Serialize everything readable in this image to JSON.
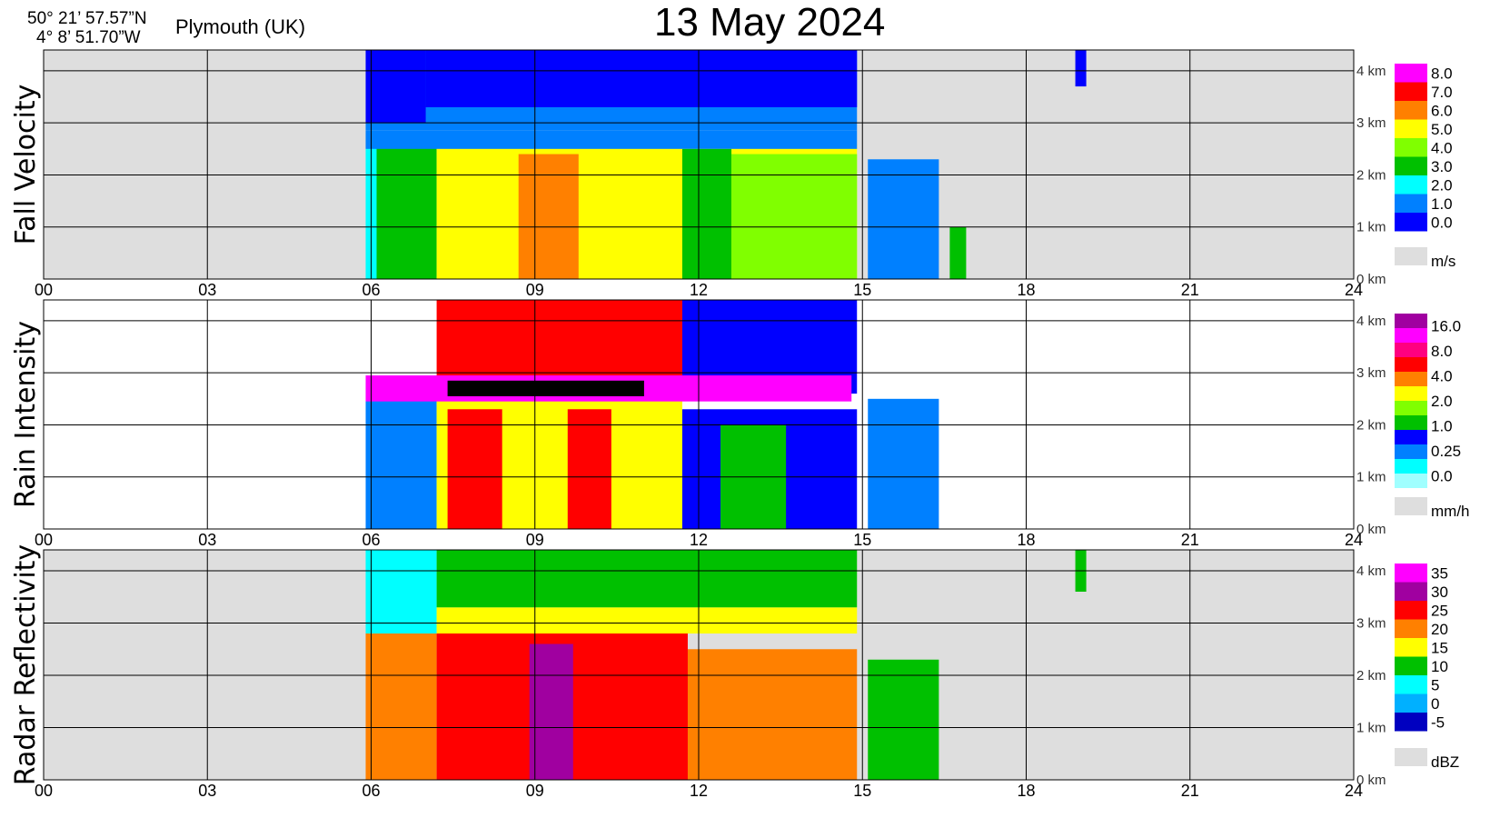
{
  "header": {
    "lat": "50° 21’ 57.57”N",
    "lon": "4°  8’ 51.70”W",
    "place": "Plymouth (UK)",
    "title": "13 May  2024"
  },
  "chart_data": [
    {
      "type": "heatmap",
      "ylabel": "Fall Velocity",
      "unit": "m/s",
      "x_ticks": [
        "00",
        "03",
        "06",
        "09",
        "12",
        "15",
        "18",
        "21",
        "24"
      ],
      "xlim": [
        0,
        24
      ],
      "y_ticks": [
        "0 km",
        "1 km",
        "2 km",
        "3 km",
        "4 km"
      ],
      "ylim_km": [
        0,
        4.4
      ],
      "nodata_color": "#dedede",
      "colorbar": {
        "labels": [
          "8.0",
          "7.0",
          "6.0",
          "5.0",
          "4.0",
          "3.0",
          "2.0",
          "1.0",
          "0.0"
        ],
        "colors": [
          "#ff00ff",
          "#ff0000",
          "#ff8000",
          "#ffff00",
          "#80ff00",
          "#00c000",
          "#00ffff",
          "#0080ff",
          "#0000ff"
        ]
      },
      "bands": [
        {
          "t0": 5.9,
          "t1": 6.1,
          "h0": 0,
          "h1": 2.8,
          "color": "#00ffff"
        },
        {
          "t0": 6.1,
          "t1": 7.2,
          "h0": 0,
          "h1": 2.8,
          "color": "#00c000"
        },
        {
          "t0": 7.2,
          "t1": 14.9,
          "h0": 0,
          "h1": 2.6,
          "color": "#ffff00"
        },
        {
          "t0": 8.7,
          "t1": 9.8,
          "h0": 0,
          "h1": 2.4,
          "color": "#ff8000"
        },
        {
          "t0": 11.7,
          "t1": 12.6,
          "h0": 0,
          "h1": 2.5,
          "color": "#00c000"
        },
        {
          "t0": 12.6,
          "t1": 14.9,
          "h0": 0,
          "h1": 2.4,
          "color": "#80ff00"
        },
        {
          "t0": 5.9,
          "t1": 14.9,
          "h0": 2.5,
          "h1": 2.85,
          "color": "#0080ff"
        },
        {
          "t0": 5.9,
          "t1": 14.9,
          "h0": 2.85,
          "h1": 4.4,
          "color": "#0080ff"
        },
        {
          "t0": 5.9,
          "t1": 7.0,
          "h0": 3.0,
          "h1": 4.4,
          "color": "#0000ff"
        },
        {
          "t0": 7.0,
          "t1": 14.9,
          "h0": 3.3,
          "h1": 4.4,
          "color": "#0000ff"
        },
        {
          "t0": 15.1,
          "t1": 16.4,
          "h0": 0,
          "h1": 2.3,
          "color": "#0080ff"
        },
        {
          "t0": 16.6,
          "t1": 16.9,
          "h0": 0,
          "h1": 1.0,
          "color": "#00c000"
        },
        {
          "t0": 18.9,
          "t1": 19.1,
          "h0": 3.7,
          "h1": 4.4,
          "color": "#0000ff"
        }
      ]
    },
    {
      "type": "heatmap",
      "ylabel": "Rain Intensity",
      "unit": "mm/h",
      "x_ticks": [
        "00",
        "03",
        "06",
        "09",
        "12",
        "15",
        "18",
        "21",
        "24"
      ],
      "xlim": [
        0,
        24
      ],
      "y_ticks": [
        "0 km",
        "1 km",
        "2 km",
        "3 km",
        "4 km"
      ],
      "ylim_km": [
        0,
        4.4
      ],
      "nodata_color": "#ffffff",
      "colorbar": {
        "labels": [
          "16.0",
          "8.0",
          "4.0",
          "2.0",
          "1.0",
          "0.25",
          "0.0"
        ],
        "colors": [
          "#a000a0",
          "#ff00ff",
          "#ff0080",
          "#ff0000",
          "#ff8000",
          "#ffff00",
          "#80ff00",
          "#00c000",
          "#0000ff",
          "#0080ff",
          "#00ffff",
          "#a0ffff"
        ]
      },
      "bands": [
        {
          "t0": 5.9,
          "t1": 7.2,
          "h0": 0,
          "h1": 2.8,
          "color": "#0080ff"
        },
        {
          "t0": 7.2,
          "t1": 11.7,
          "h0": 0,
          "h1": 2.5,
          "color": "#ffff00"
        },
        {
          "t0": 7.4,
          "t1": 8.4,
          "h0": 0,
          "h1": 2.3,
          "color": "#ff0000"
        },
        {
          "t0": 9.6,
          "t1": 10.4,
          "h0": 0,
          "h1": 2.3,
          "color": "#ff0000"
        },
        {
          "t0": 11.7,
          "t1": 14.9,
          "h0": 0,
          "h1": 2.3,
          "color": "#0000ff"
        },
        {
          "t0": 12.4,
          "t1": 13.6,
          "h0": 0,
          "h1": 2.0,
          "color": "#00c000"
        },
        {
          "t0": 7.2,
          "t1": 11.7,
          "h0": 2.5,
          "h1": 4.4,
          "color": "#ff0000"
        },
        {
          "t0": 11.7,
          "t1": 14.9,
          "h0": 2.6,
          "h1": 4.4,
          "color": "#0000ff"
        },
        {
          "t0": 5.9,
          "t1": 14.8,
          "h0": 2.45,
          "h1": 2.95,
          "color": "#ff00ff"
        },
        {
          "t0": 7.4,
          "t1": 11.0,
          "h0": 2.55,
          "h1": 2.85,
          "color": "#000000"
        },
        {
          "t0": 15.1,
          "t1": 16.4,
          "h0": 0,
          "h1": 2.5,
          "color": "#0080ff"
        }
      ]
    },
    {
      "type": "heatmap",
      "ylabel": "Radar Reflectivity",
      "unit": "dBZ",
      "x_ticks": [
        "00",
        "03",
        "06",
        "09",
        "12",
        "15",
        "18",
        "21",
        "24"
      ],
      "xlim": [
        0,
        24
      ],
      "y_ticks": [
        "0 km",
        "1 km",
        "2 km",
        "3 km",
        "4 km"
      ],
      "ylim_km": [
        0,
        4.4
      ],
      "nodata_color": "#dedede",
      "colorbar": {
        "labels": [
          "35",
          "30",
          "25",
          "20",
          "15",
          "10",
          "5",
          "0",
          "-5"
        ],
        "colors": [
          "#ff00ff",
          "#a000a0",
          "#ff0000",
          "#ff8000",
          "#ffff00",
          "#00c000",
          "#00ffff",
          "#00b0ff",
          "#0000c0"
        ]
      },
      "bands": [
        {
          "t0": 5.9,
          "t1": 7.2,
          "h0": 0,
          "h1": 2.8,
          "color": "#ff8000"
        },
        {
          "t0": 7.2,
          "t1": 11.8,
          "h0": 0,
          "h1": 2.8,
          "color": "#ff0000"
        },
        {
          "t0": 8.9,
          "t1": 9.7,
          "h0": 0,
          "h1": 2.6,
          "color": "#a000a0"
        },
        {
          "t0": 11.8,
          "t1": 14.9,
          "h0": 0,
          "h1": 2.5,
          "color": "#ff8000"
        },
        {
          "t0": 5.9,
          "t1": 7.2,
          "h0": 2.8,
          "h1": 4.4,
          "color": "#00ffff"
        },
        {
          "t0": 7.2,
          "t1": 14.9,
          "h0": 2.8,
          "h1": 3.3,
          "color": "#ffff00"
        },
        {
          "t0": 7.2,
          "t1": 14.9,
          "h0": 3.3,
          "h1": 4.4,
          "color": "#00c000"
        },
        {
          "t0": 15.1,
          "t1": 16.4,
          "h0": 0,
          "h1": 2.3,
          "color": "#00c000"
        },
        {
          "t0": 18.9,
          "t1": 19.1,
          "h0": 3.6,
          "h1": 4.4,
          "color": "#00c000"
        }
      ]
    }
  ]
}
